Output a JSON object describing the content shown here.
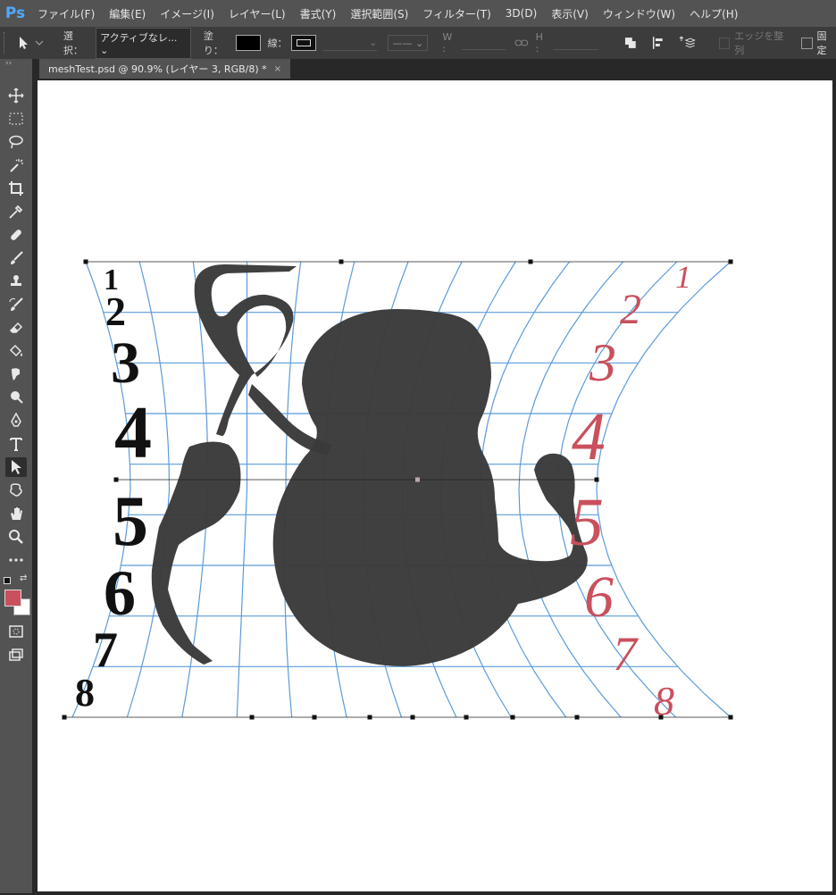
{
  "app": {
    "logo": "Ps"
  },
  "menu": [
    "ファイル(F)",
    "編集(E)",
    "イメージ(I)",
    "レイヤー(L)",
    "書式(Y)",
    "選択範囲(S)",
    "フィルター(T)",
    "3D(D)",
    "表示(V)",
    "ウィンドウ(W)",
    "ヘルプ(H)"
  ],
  "options": {
    "select_label": "選択：",
    "select_value": "アクティブなレ...",
    "fill_label": "塗り：",
    "stroke_label": "線：",
    "w_label": "W :",
    "h_label": "H :",
    "align_edges": "エッジを整列",
    "constrain": "固定"
  },
  "tab": {
    "title": "meshTest.psd @ 90.9% (レイヤー 3, RGB/8) *",
    "close": "×"
  },
  "canvas": {
    "left_numbers": [
      "1",
      "2",
      "3",
      "4",
      "5",
      "6",
      "7",
      "8"
    ],
    "right_numbers": [
      "1",
      "2",
      "3",
      "4",
      "5",
      "6",
      "7",
      "8"
    ],
    "right_color": "#c9505c",
    "grid_color": "#5b9bd8",
    "shape_color": "#3a3a3a"
  },
  "colors": {
    "foreground": "#c9505c",
    "background": "#ffffff"
  },
  "icons": [
    "move-tool-icon",
    "marquee-tool-icon",
    "lasso-tool-icon",
    "magic-wand-icon",
    "crop-tool-icon",
    "eyedropper-icon",
    "healing-brush-icon",
    "brush-tool-icon",
    "stamp-tool-icon",
    "history-brush-icon",
    "eraser-icon",
    "paint-bucket-icon",
    "smudge-icon",
    "dodge-icon",
    "pen-tool-icon",
    "type-tool-icon",
    "path-select-icon",
    "custom-shape-icon",
    "hand-tool-icon",
    "zoom-tool-icon",
    "more-tools-icon",
    "quick-mask-icon",
    "screen-mode-icon"
  ]
}
